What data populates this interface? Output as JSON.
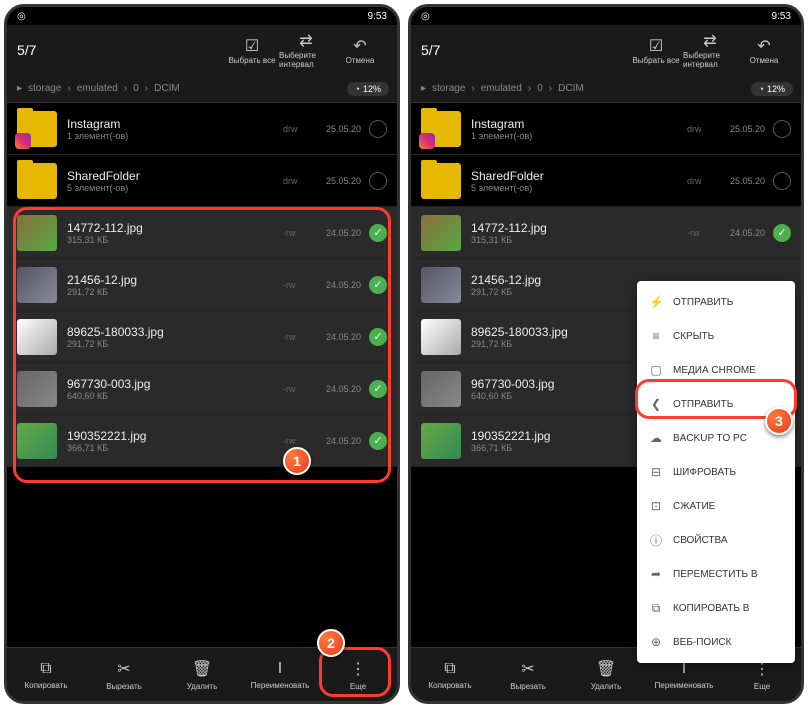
{
  "status": {
    "time": "9:53"
  },
  "top": {
    "count": "5/7",
    "selectAll": "Выбрать все",
    "interval": "Выберите интервал",
    "cancel": "Отмена"
  },
  "breadcrumb": [
    "storage",
    "emulated",
    "0",
    "DCIM"
  ],
  "storage": "12%",
  "folders": [
    {
      "name": "Instagram",
      "meta": "1 элемент(-ов)",
      "perm": "drw",
      "date": "25.05.20",
      "insta": true
    },
    {
      "name": "SharedFolder",
      "meta": "5 элемент(-ов)",
      "perm": "drw",
      "date": "25.05.20",
      "insta": false
    }
  ],
  "files": [
    {
      "name": "14772-112.jpg",
      "size": "315,31 КБ",
      "perm": "-rw",
      "date": "24.05.20",
      "thumb": "t1"
    },
    {
      "name": "21456-12.jpg",
      "size": "291,72 КБ",
      "perm": "-rw",
      "date": "24.05.20",
      "thumb": "t2"
    },
    {
      "name": "89625-180033.jpg",
      "size": "291,72 КБ",
      "perm": "-rw",
      "date": "24.05.20",
      "thumb": "t3"
    },
    {
      "name": "967730-003.jpg",
      "size": "640,60 КБ",
      "perm": "-rw",
      "date": "24.05.20",
      "thumb": "t4"
    },
    {
      "name": "190352221.jpg",
      "size": "366,71 КБ",
      "perm": "-rw",
      "date": "24.05.20",
      "thumb": "t5"
    }
  ],
  "bottom": {
    "copy": "Копировать",
    "cut": "Вырезать",
    "delete": "Удалить",
    "rename": "Переименовать",
    "more": "Еще"
  },
  "menu": [
    {
      "icon": "⚡",
      "label": "ОТПРАВИТЬ"
    },
    {
      "icon": "≡",
      "label": "СКРЫТЬ"
    },
    {
      "icon": "▢",
      "label": "МЕДИА CHROME"
    },
    {
      "icon": "❮",
      "label": "ОТПРАВИТЬ"
    },
    {
      "icon": "☁",
      "label": "BACKUP TO PC"
    },
    {
      "icon": "⊟",
      "label": "ШИФРОВАТЬ"
    },
    {
      "icon": "⊡",
      "label": "СЖАТИЕ"
    },
    {
      "icon": "ⓘ",
      "label": "СВОЙСТВА"
    },
    {
      "icon": "➦",
      "label": "ПЕРЕМЕСТИТЬ В"
    },
    {
      "icon": "⧉",
      "label": "КОПИРОВАТЬ В"
    },
    {
      "icon": "⊕",
      "label": "ВЕБ-ПОИСК"
    }
  ],
  "badges": {
    "one": "1",
    "two": "2",
    "three": "3"
  }
}
